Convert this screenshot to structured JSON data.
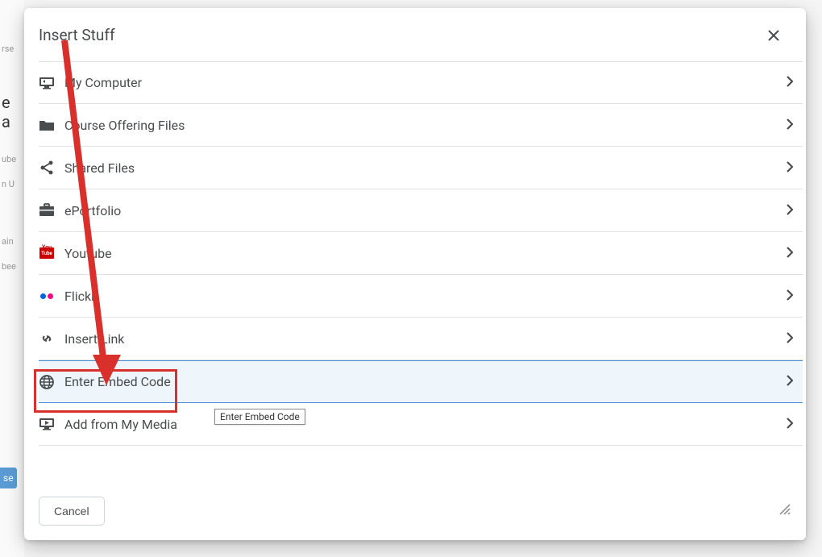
{
  "dialog": {
    "title": "Insert Stuff",
    "cancel_label": "Cancel",
    "tooltip": "Enter Embed Code"
  },
  "items": [
    {
      "id": "my-computer",
      "label": "My Computer",
      "icon": "display-icon"
    },
    {
      "id": "course-offering-files",
      "label": "Course Offering Files",
      "icon": "folder-icon"
    },
    {
      "id": "shared-files",
      "label": "Shared Files",
      "icon": "share-icon"
    },
    {
      "id": "eportfolio",
      "label": "ePortfolio",
      "icon": "briefcase-icon"
    },
    {
      "id": "youtube",
      "label": "Youtube",
      "icon": "youtube-icon"
    },
    {
      "id": "flickr",
      "label": "Flickr",
      "icon": "flickr-icon"
    },
    {
      "id": "insert-link",
      "label": "Insert Link",
      "icon": "link-icon"
    },
    {
      "id": "enter-embed-code",
      "label": "Enter Embed Code",
      "icon": "globe-icon",
      "highlighted": true
    },
    {
      "id": "add-from-my-media",
      "label": "Add from My Media",
      "icon": "media-icon"
    }
  ],
  "annotation": {
    "arrow_color": "#d9302c",
    "box_color": "#d9302c"
  },
  "bg_fragments": {
    "a": "rse",
    "b": "e a",
    "c": "ube",
    "d": "n U",
    "e": "ain",
    "f": "bee",
    "g": "se"
  }
}
